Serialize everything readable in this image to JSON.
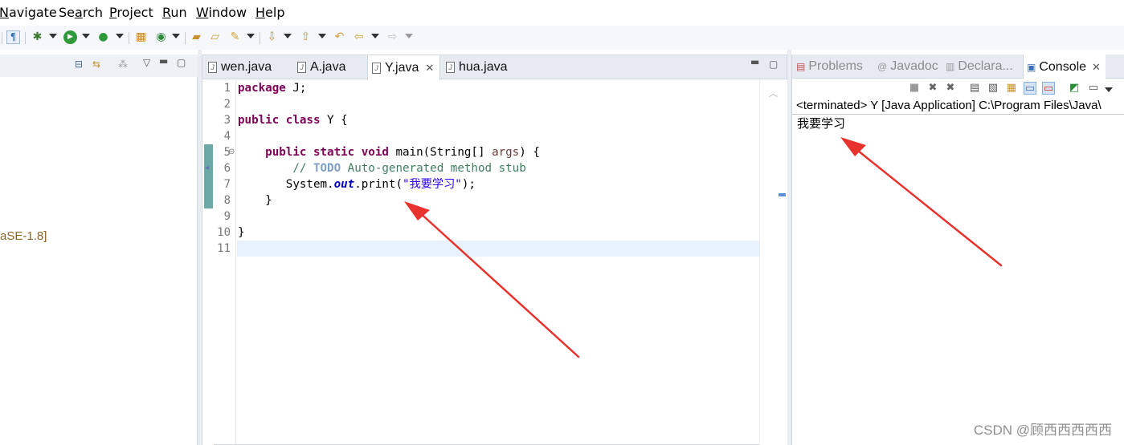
{
  "menu": {
    "items": [
      {
        "label": "Navigate",
        "underline": "N"
      },
      {
        "label": "Search",
        "underline": "a"
      },
      {
        "label": "Project",
        "underline": "P"
      },
      {
        "label": "Run",
        "underline": "R"
      },
      {
        "label": "Window",
        "underline": "W"
      },
      {
        "label": "Help",
        "underline": "H"
      }
    ]
  },
  "toolbar": {
    "icons": [
      "show-whitespace-icon",
      "debug-icon",
      "run-icon",
      "external-tools-icon",
      "new-java-package-icon",
      "new-java-class-icon",
      "open-type-icon",
      "open-task-icon",
      "search-icon",
      "next-annotation-icon",
      "previous-annotation-icon",
      "last-edit-location-icon",
      "back-icon",
      "forward-icon"
    ]
  },
  "left_panel": {
    "jre_label": "aSE-1.8]"
  },
  "editor": {
    "tabs": [
      {
        "label": "wen.java",
        "active": false
      },
      {
        "label": "A.java",
        "active": false
      },
      {
        "label": "Y.java",
        "active": true
      },
      {
        "label": "hua.java",
        "active": false
      }
    ],
    "close_glyph": "✕",
    "line_numbers": [
      "1",
      "2",
      "3",
      "4",
      "5",
      "6",
      "7",
      "8",
      "9",
      "10",
      "11"
    ],
    "code": {
      "line1": {
        "kw": "package",
        "rest": " J;"
      },
      "line3": {
        "kw1": "public",
        "kw2": "class",
        "rest": " Y {"
      },
      "line5": {
        "kw1": "public",
        "kw2": "static",
        "kw3": "void",
        "name": " main(String[] ",
        "param": "args",
        "end": ") {"
      },
      "line6": {
        "prefix": "// ",
        "todo": "TODO",
        "rest": " Auto-generated method stub"
      },
      "line7": {
        "obj": "System.",
        "field": "out",
        "call": ".print(",
        "str": "\"我要学习\"",
        "end": ");"
      },
      "line8": "}",
      "line10": "}"
    }
  },
  "console": {
    "tabs": [
      {
        "label": "Problems",
        "active": false
      },
      {
        "label": "Javadoc",
        "active": false
      },
      {
        "label": "Declara...",
        "active": false
      },
      {
        "label": "Console",
        "active": true
      }
    ],
    "status": "<terminated> Y [Java Application] C:\\Program Files\\Java\\",
    "output": "我要学习"
  },
  "watermark": "CSDN @顾西西西西西",
  "colors": {
    "keyword": "#7f0055",
    "comment": "#3f7f5f",
    "string": "#2a00ff",
    "field": "#0000c0",
    "annotation_arrow": "#e8322e"
  }
}
